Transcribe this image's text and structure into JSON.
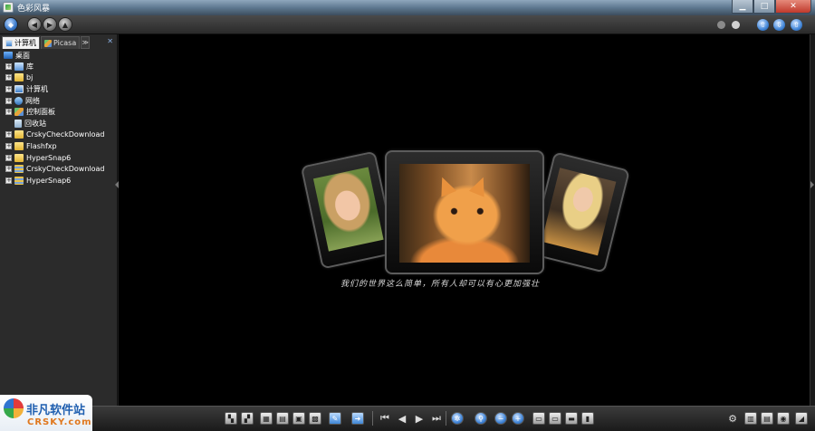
{
  "window": {
    "title": "色彩风暴",
    "buttons": {
      "minimize": "▁",
      "maximize": "□",
      "close": "✕"
    }
  },
  "navbar": {
    "back": "◀",
    "forward": "▶",
    "up": "▲",
    "arrows": [
      "⇧",
      "⇩",
      "⇧"
    ]
  },
  "sidebar": {
    "tabs": [
      {
        "label": "计算机",
        "icon": "computer-icon",
        "active": true
      },
      {
        "label": "Picasa",
        "icon": "picasa-icon",
        "active": false
      }
    ],
    "more": "≫",
    "close": "✕",
    "root": "桌面",
    "items": [
      {
        "label": "库",
        "icon": "library-icon",
        "expander": "+"
      },
      {
        "label": "bj",
        "icon": "folder-icon",
        "expander": "+"
      },
      {
        "label": "计算机",
        "icon": "computer-icon",
        "expander": "+"
      },
      {
        "label": "网络",
        "icon": "network-icon",
        "expander": "+"
      },
      {
        "label": "控制面板",
        "icon": "control-panel-icon",
        "expander": "+"
      },
      {
        "label": "回收站",
        "icon": "recycle-bin-icon",
        "expander": ""
      },
      {
        "label": "CrskyCheckDownload",
        "icon": "folder-icon",
        "expander": "+"
      },
      {
        "label": "Flashfxp",
        "icon": "folder-icon",
        "expander": "+"
      },
      {
        "label": "HyperSnap6",
        "icon": "folder-icon",
        "expander": "+"
      },
      {
        "label": "CrskyCheckDownload",
        "icon": "archive-icon",
        "expander": "+"
      },
      {
        "label": "HyperSnap6",
        "icon": "archive-icon",
        "expander": "+"
      }
    ]
  },
  "viewer": {
    "caption": "我们的世界这么简单，所有人却可以有心更加强壮",
    "photos": [
      "girl-photo",
      "kitten-photo",
      "woman-photo"
    ]
  },
  "toolbar": {
    "first": "⏮",
    "prev": "◀",
    "play": "▶",
    "last": "⏭",
    "zoom_in": "+",
    "zoom_out": "−"
  },
  "watermark": {
    "main": "非凡软件站",
    "sub": "CRSKY.com"
  }
}
